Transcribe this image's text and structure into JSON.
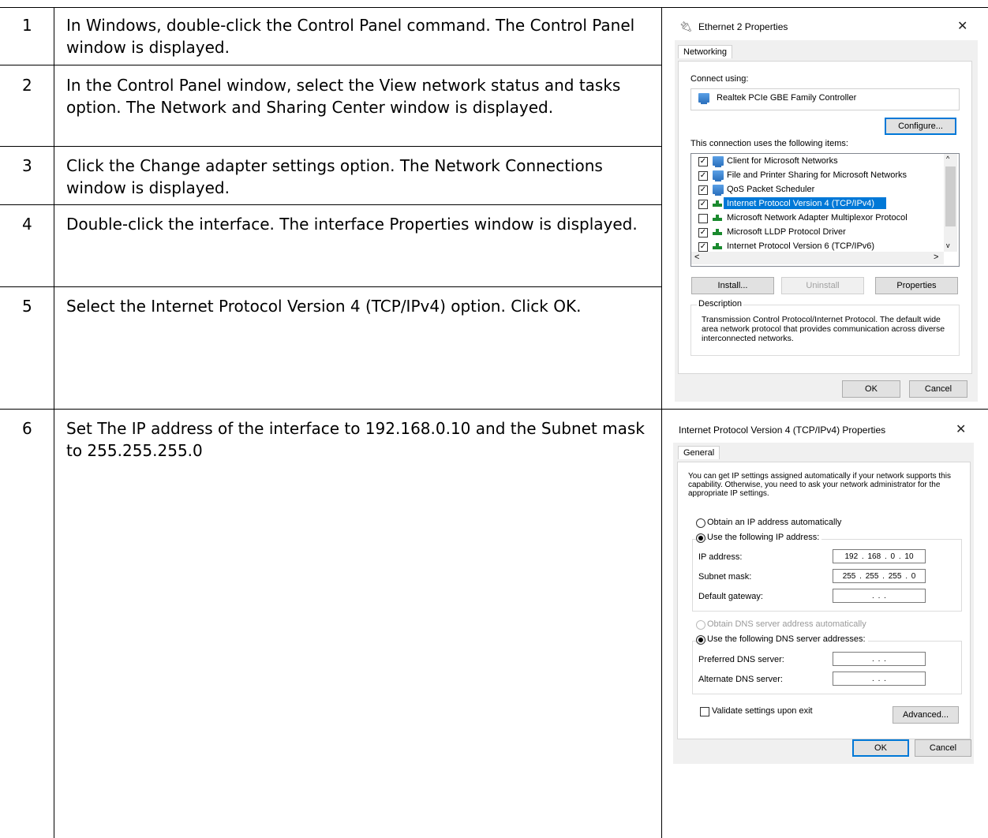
{
  "steps": [
    {
      "num": "1",
      "text": "In Windows, double-click the Control Panel command. The Control Panel window is displayed."
    },
    {
      "num": "2",
      "text": "In the Control Panel window, select the View network status and tasks option. The Network and Sharing Center window is displayed."
    },
    {
      "num": "3",
      "text": "Click the Change adapter settings option. The Network Connections window is displayed."
    },
    {
      "num": "4",
      "text": "Double-click the interface. The interface Properties window is displayed."
    },
    {
      "num": "5",
      "text": "Select the Internet Protocol Version 4 (TCP/IPv4) option. Click OK."
    },
    {
      "num": "6",
      "text": "Set The IP address of the interface to 192.168.0.10 and the Subnet mask to 255.255.255.0"
    }
  ],
  "ethernet_dialog": {
    "title": "Ethernet 2 Properties",
    "tab": "Networking",
    "connect_using_label": "Connect using:",
    "adapter": "Realtek PCIe GBE Family Controller",
    "configure_button": "Configure...",
    "items_label": "This connection uses the following items:",
    "items": [
      {
        "label": "Client for Microsoft Networks",
        "checked": true,
        "icon": "network-client-icon"
      },
      {
        "label": "File and Printer Sharing for Microsoft Networks",
        "checked": true,
        "icon": "network-service-icon"
      },
      {
        "label": "QoS Packet Scheduler",
        "checked": true,
        "icon": "network-service-icon"
      },
      {
        "label": "Internet Protocol Version 4 (TCP/IPv4)",
        "checked": true,
        "icon": "protocol-icon",
        "selected": true
      },
      {
        "label": "Microsoft Network Adapter Multiplexor Protocol",
        "checked": false,
        "icon": "protocol-icon"
      },
      {
        "label": "Microsoft LLDP Protocol Driver",
        "checked": true,
        "icon": "protocol-icon"
      },
      {
        "label": "Internet Protocol Version 6 (TCP/IPv6)",
        "checked": true,
        "icon": "protocol-icon"
      }
    ],
    "install_button": "Install...",
    "uninstall_button": "Uninstall",
    "properties_button": "Properties",
    "description_label": "Description",
    "description_text": "Transmission Control Protocol/Internet Protocol. The default wide area network protocol that provides communication across diverse interconnected networks.",
    "ok_button": "OK",
    "cancel_button": "Cancel"
  },
  "ipv4_dialog": {
    "title": "Internet Protocol Version 4 (TCP/IPv4) Properties",
    "tab": "General",
    "intro": "You can get IP settings assigned automatically if your network supports this capability. Otherwise, you need to ask your network administrator for the appropriate IP settings.",
    "obtain_ip_auto": "Obtain an IP address automatically",
    "use_following_ip": "Use the following IP address:",
    "ip_address_label": "IP address:",
    "ip_address_value": "192 . 168 . 0 . 10",
    "subnet_mask_label": "Subnet mask:",
    "subnet_mask_value": "255 . 255 . 255 . 0",
    "default_gateway_label": "Default gateway:",
    "default_gateway_value": ". . .",
    "obtain_dns_auto": "Obtain DNS server address automatically",
    "use_following_dns": "Use the following DNS server addresses:",
    "preferred_dns_label": "Preferred DNS server:",
    "preferred_dns_value": ". . .",
    "alternate_dns_label": "Alternate DNS server:",
    "alternate_dns_value": ". . .",
    "validate_label": "Validate settings upon exit",
    "advanced_button": "Advanced...",
    "ok_button": "OK",
    "cancel_button": "Cancel"
  }
}
